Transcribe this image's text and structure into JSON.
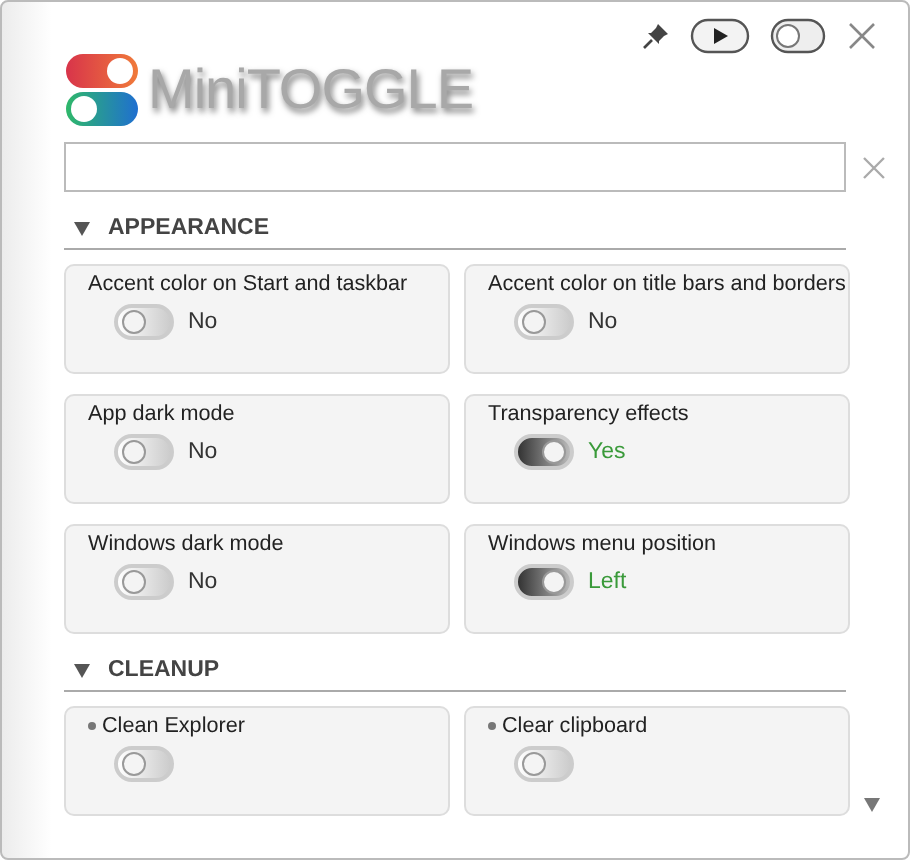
{
  "app": {
    "title": "MiniTOGGLE"
  },
  "sections": [
    {
      "title": "APPEARANCE",
      "expanded": true,
      "items": [
        {
          "kind": "setting",
          "label": "Accent color on Start and taskbar",
          "on": false,
          "value": "No"
        },
        {
          "kind": "setting",
          "label": "Accent color on title bars and borders",
          "on": false,
          "value": "No"
        },
        {
          "kind": "setting",
          "label": "App dark mode",
          "on": false,
          "value": "No"
        },
        {
          "kind": "setting",
          "label": "Transparency effects",
          "on": true,
          "value": "Yes"
        },
        {
          "kind": "setting",
          "label": "Windows dark mode",
          "on": false,
          "value": "No"
        },
        {
          "kind": "setting",
          "label": "Windows menu position",
          "on": true,
          "value": "Left"
        }
      ]
    },
    {
      "title": "CLEANUP",
      "expanded": true,
      "items": [
        {
          "kind": "action",
          "label": "Clean Explorer",
          "on": false
        },
        {
          "kind": "action",
          "label": "Clear clipboard",
          "on": false
        }
      ]
    }
  ]
}
